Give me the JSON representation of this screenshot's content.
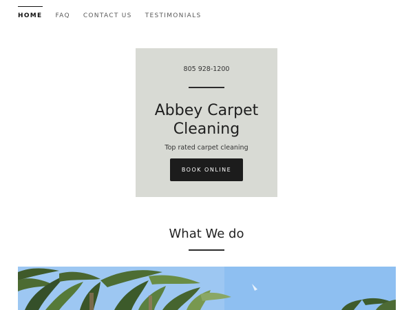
{
  "nav": {
    "items": [
      {
        "label": "HOME",
        "active": true
      },
      {
        "label": "FAQ",
        "active": false
      },
      {
        "label": "CONTACT US",
        "active": false
      },
      {
        "label": "TESTIMONIALS",
        "active": false
      }
    ]
  },
  "hero": {
    "phone": "805 928-1200",
    "title_line1": "Abbey Carpet",
    "title_line2": "Cleaning",
    "tagline": "Top rated carpet cleaning",
    "button_label": "BOOK ONLINE",
    "background_color": "#d8dad4"
  },
  "section": {
    "title": "What We do"
  },
  "colors": {
    "accent": "#1c1c1c",
    "text": "#1a1a1a",
    "sky": "#9cc6f2"
  }
}
